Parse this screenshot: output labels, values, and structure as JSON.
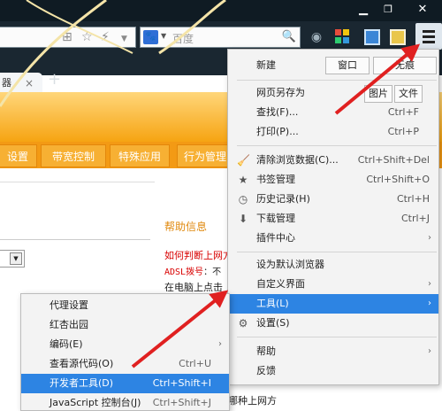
{
  "window": {
    "min_icon": "minimize-icon",
    "max_icon": "maximize-icon",
    "close_icon": "close-icon",
    "min": "▁",
    "max": "❐",
    "close": "✕"
  },
  "toolbar": {
    "search_placeholder": "百度",
    "search_engine_logo": "🐾",
    "icons": [
      "grid-icon",
      "star-icon",
      "bolt-icon",
      "dropdown-icon",
      "wifi-icon",
      "apps-icon",
      "screenshot-icon",
      "photo-icon",
      "hamburger-menu-icon"
    ]
  },
  "tabs": {
    "active_label": "器",
    "close": "×",
    "new": "+"
  },
  "page": {
    "nav": [
      "设置",
      "带宽控制",
      "特殊应用",
      "行为管理"
    ],
    "help_title": "帮助信息",
    "help_line1": "如何判断上网方",
    "help_line2_prefix": "ADSL拨号",
    "help_line2_suffix": "：不",
    "help_line3": "在电脑上点击",
    "help_bottom": "哪种上网方"
  },
  "main_menu": {
    "new_label": "新建",
    "new_window_button": "窗口",
    "new_incognito_button": "无痕",
    "save_as": "网页另存为",
    "save_image_button": "图片",
    "save_file_button": "文件",
    "find": "查找(F)...",
    "find_shortcut": "Ctrl+F",
    "print": "打印(P)...",
    "print_shortcut": "Ctrl+P",
    "clear_data": "清除浏览数据(C)...",
    "clear_data_shortcut": "Ctrl+Shift+Del",
    "bookmarks": "书签管理",
    "bookmarks_shortcut": "Ctrl+Shift+O",
    "history": "历史记录(H)",
    "history_shortcut": "Ctrl+H",
    "downloads": "下载管理",
    "downloads_shortcut": "Ctrl+J",
    "plugins": "插件中心",
    "set_default": "设为默认浏览器",
    "customize": "自定义界面",
    "tools": "工具(L)",
    "settings": "设置(S)",
    "help": "帮助",
    "feedback": "反馈"
  },
  "sub_menu": {
    "proxy": "代理设置",
    "apricot": "红杏出园",
    "encoding": "编码(E)",
    "view_source": "查看源代码(O)",
    "view_source_shortcut": "Ctrl+U",
    "devtools": "开发者工具(D)",
    "devtools_shortcut": "Ctrl+Shift+I",
    "js_console": "JavaScript 控制台(J)",
    "js_console_shortcut": "Ctrl+Shift+J"
  },
  "colors": {
    "chrome_dark": "#1a2731",
    "menu_highlight": "#2d84e3",
    "page_orange": "#f39a14",
    "annotation_red": "#e02020"
  }
}
